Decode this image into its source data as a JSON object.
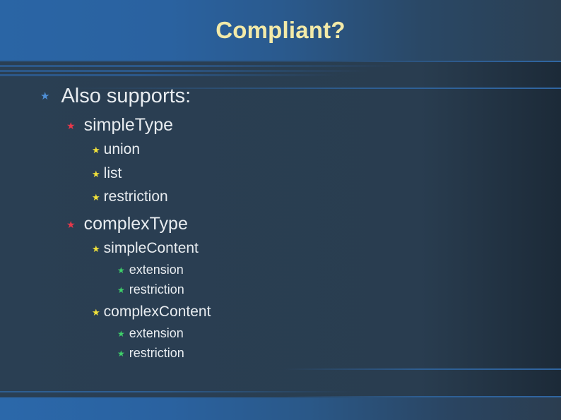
{
  "slide": {
    "title": "Compliant?",
    "bullets": [
      {
        "level": 1,
        "icon": "blue-star-icon",
        "text": "Also supports:"
      },
      {
        "level": 2,
        "icon": "red-star-icon",
        "text": "simpleType"
      },
      {
        "level": 3,
        "icon": "yellow-star-icon",
        "text": "union"
      },
      {
        "level": 3,
        "icon": "yellow-star-icon",
        "text": "list"
      },
      {
        "level": 3,
        "icon": "yellow-star-icon",
        "text": "restriction"
      },
      {
        "level": 2,
        "icon": "red-star-icon",
        "text": "complexType"
      },
      {
        "level": 3,
        "icon": "yellow-star-icon",
        "text": "simpleContent"
      },
      {
        "level": 4,
        "icon": "green-star-icon",
        "text": "extension"
      },
      {
        "level": 4,
        "icon": "green-star-icon",
        "text": "restriction"
      },
      {
        "level": 3,
        "icon": "yellow-star-icon",
        "text": "complexContent"
      },
      {
        "level": 4,
        "icon": "green-star-icon",
        "text": "extension"
      },
      {
        "level": 4,
        "icon": "green-star-icon",
        "text": "restriction"
      }
    ],
    "star_glyph": "★",
    "colors": {
      "title": "#f3eaa8",
      "body_text": "#e8ecf0",
      "level1_star": "#4f8fd6",
      "level2_star": "#e8384a",
      "level3_star": "#f2e23a",
      "level4_star": "#3fd06a"
    }
  }
}
